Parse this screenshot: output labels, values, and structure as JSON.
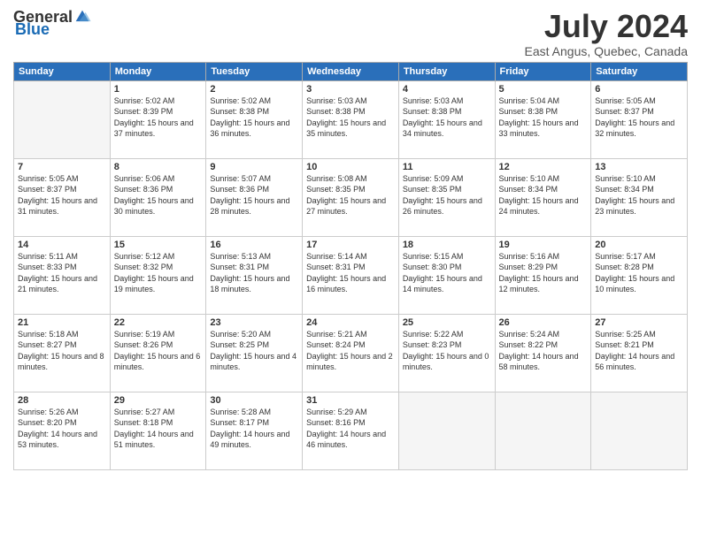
{
  "header": {
    "logo_general": "General",
    "logo_blue": "Blue",
    "month_title": "July 2024",
    "location": "East Angus, Quebec, Canada"
  },
  "weekdays": [
    "Sunday",
    "Monday",
    "Tuesday",
    "Wednesday",
    "Thursday",
    "Friday",
    "Saturday"
  ],
  "weeks": [
    [
      {
        "num": "",
        "empty": true
      },
      {
        "num": "1",
        "sunrise": "5:02 AM",
        "sunset": "8:39 PM",
        "daylight": "15 hours and 37 minutes."
      },
      {
        "num": "2",
        "sunrise": "5:02 AM",
        "sunset": "8:38 PM",
        "daylight": "15 hours and 36 minutes."
      },
      {
        "num": "3",
        "sunrise": "5:03 AM",
        "sunset": "8:38 PM",
        "daylight": "15 hours and 35 minutes."
      },
      {
        "num": "4",
        "sunrise": "5:03 AM",
        "sunset": "8:38 PM",
        "daylight": "15 hours and 34 minutes."
      },
      {
        "num": "5",
        "sunrise": "5:04 AM",
        "sunset": "8:38 PM",
        "daylight": "15 hours and 33 minutes."
      },
      {
        "num": "6",
        "sunrise": "5:05 AM",
        "sunset": "8:37 PM",
        "daylight": "15 hours and 32 minutes."
      }
    ],
    [
      {
        "num": "7",
        "sunrise": "5:05 AM",
        "sunset": "8:37 PM",
        "daylight": "15 hours and 31 minutes."
      },
      {
        "num": "8",
        "sunrise": "5:06 AM",
        "sunset": "8:36 PM",
        "daylight": "15 hours and 30 minutes."
      },
      {
        "num": "9",
        "sunrise": "5:07 AM",
        "sunset": "8:36 PM",
        "daylight": "15 hours and 28 minutes."
      },
      {
        "num": "10",
        "sunrise": "5:08 AM",
        "sunset": "8:35 PM",
        "daylight": "15 hours and 27 minutes."
      },
      {
        "num": "11",
        "sunrise": "5:09 AM",
        "sunset": "8:35 PM",
        "daylight": "15 hours and 26 minutes."
      },
      {
        "num": "12",
        "sunrise": "5:10 AM",
        "sunset": "8:34 PM",
        "daylight": "15 hours and 24 minutes."
      },
      {
        "num": "13",
        "sunrise": "5:10 AM",
        "sunset": "8:34 PM",
        "daylight": "15 hours and 23 minutes."
      }
    ],
    [
      {
        "num": "14",
        "sunrise": "5:11 AM",
        "sunset": "8:33 PM",
        "daylight": "15 hours and 21 minutes."
      },
      {
        "num": "15",
        "sunrise": "5:12 AM",
        "sunset": "8:32 PM",
        "daylight": "15 hours and 19 minutes."
      },
      {
        "num": "16",
        "sunrise": "5:13 AM",
        "sunset": "8:31 PM",
        "daylight": "15 hours and 18 minutes."
      },
      {
        "num": "17",
        "sunrise": "5:14 AM",
        "sunset": "8:31 PM",
        "daylight": "15 hours and 16 minutes."
      },
      {
        "num": "18",
        "sunrise": "5:15 AM",
        "sunset": "8:30 PM",
        "daylight": "15 hours and 14 minutes."
      },
      {
        "num": "19",
        "sunrise": "5:16 AM",
        "sunset": "8:29 PM",
        "daylight": "15 hours and 12 minutes."
      },
      {
        "num": "20",
        "sunrise": "5:17 AM",
        "sunset": "8:28 PM",
        "daylight": "15 hours and 10 minutes."
      }
    ],
    [
      {
        "num": "21",
        "sunrise": "5:18 AM",
        "sunset": "8:27 PM",
        "daylight": "15 hours and 8 minutes."
      },
      {
        "num": "22",
        "sunrise": "5:19 AM",
        "sunset": "8:26 PM",
        "daylight": "15 hours and 6 minutes."
      },
      {
        "num": "23",
        "sunrise": "5:20 AM",
        "sunset": "8:25 PM",
        "daylight": "15 hours and 4 minutes."
      },
      {
        "num": "24",
        "sunrise": "5:21 AM",
        "sunset": "8:24 PM",
        "daylight": "15 hours and 2 minutes."
      },
      {
        "num": "25",
        "sunrise": "5:22 AM",
        "sunset": "8:23 PM",
        "daylight": "15 hours and 0 minutes."
      },
      {
        "num": "26",
        "sunrise": "5:24 AM",
        "sunset": "8:22 PM",
        "daylight": "14 hours and 58 minutes."
      },
      {
        "num": "27",
        "sunrise": "5:25 AM",
        "sunset": "8:21 PM",
        "daylight": "14 hours and 56 minutes."
      }
    ],
    [
      {
        "num": "28",
        "sunrise": "5:26 AM",
        "sunset": "8:20 PM",
        "daylight": "14 hours and 53 minutes."
      },
      {
        "num": "29",
        "sunrise": "5:27 AM",
        "sunset": "8:18 PM",
        "daylight": "14 hours and 51 minutes."
      },
      {
        "num": "30",
        "sunrise": "5:28 AM",
        "sunset": "8:17 PM",
        "daylight": "14 hours and 49 minutes."
      },
      {
        "num": "31",
        "sunrise": "5:29 AM",
        "sunset": "8:16 PM",
        "daylight": "14 hours and 46 minutes."
      },
      {
        "num": "",
        "empty": true
      },
      {
        "num": "",
        "empty": true
      },
      {
        "num": "",
        "empty": true
      }
    ]
  ]
}
